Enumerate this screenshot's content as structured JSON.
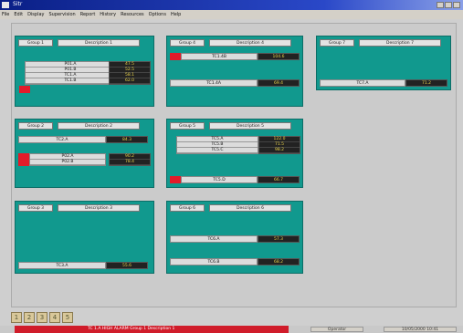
{
  "window": {
    "title": "Sitr"
  },
  "menu": [
    "File",
    "Edit",
    "Display",
    "Supervision",
    "Report",
    "History",
    "Resources",
    "Options",
    "Help"
  ],
  "panels": [
    {
      "group": "Group 1",
      "desc": "Description 1",
      "values": [
        "47.5",
        "52.5",
        "58.1",
        "62.0"
      ]
    },
    {
      "group": "Group 4",
      "desc": "Description 4",
      "values": [
        "104.6",
        "69.4"
      ]
    },
    {
      "group": "Group 7",
      "desc": "Description 7",
      "values": [
        "71.2"
      ]
    },
    {
      "group": "Group 2",
      "desc": "Description 2",
      "values": [
        "84.3",
        "90.2",
        "78.4"
      ]
    },
    {
      "group": "Group 5",
      "desc": "Description 5",
      "values": [
        "122.0",
        "71.5",
        "98.2",
        "66.7"
      ]
    },
    {
      "group": "Group 3",
      "desc": "Description 3",
      "values": [
        "55.6"
      ]
    },
    {
      "group": "Group 6",
      "desc": "Description 6",
      "values": [
        "57.3",
        "68.2"
      ]
    }
  ],
  "labels": {
    "p1": [
      "P01.A",
      "P01.B",
      "TC1.A",
      "TC1.B"
    ],
    "p4": [
      "TC1.4B",
      "TC1.4A"
    ],
    "p7": [
      "TC7.A"
    ],
    "p2": [
      "TC2.A",
      "P02.A",
      "P02.B"
    ],
    "p5": [
      "TC5.A",
      "TC5.B",
      "TC5.C",
      "TC5.D"
    ],
    "p3": [
      "TC3.A"
    ],
    "p6": [
      "TC6.A",
      "TC6.B"
    ]
  },
  "toolbar": [
    "1",
    "2",
    "3",
    "4",
    "5"
  ],
  "status": {
    "alarm": "TC 1.A HIGH ALARM  Group 1 Description 1",
    "mid": "Operator",
    "right": "10/05/2000 10:41"
  }
}
